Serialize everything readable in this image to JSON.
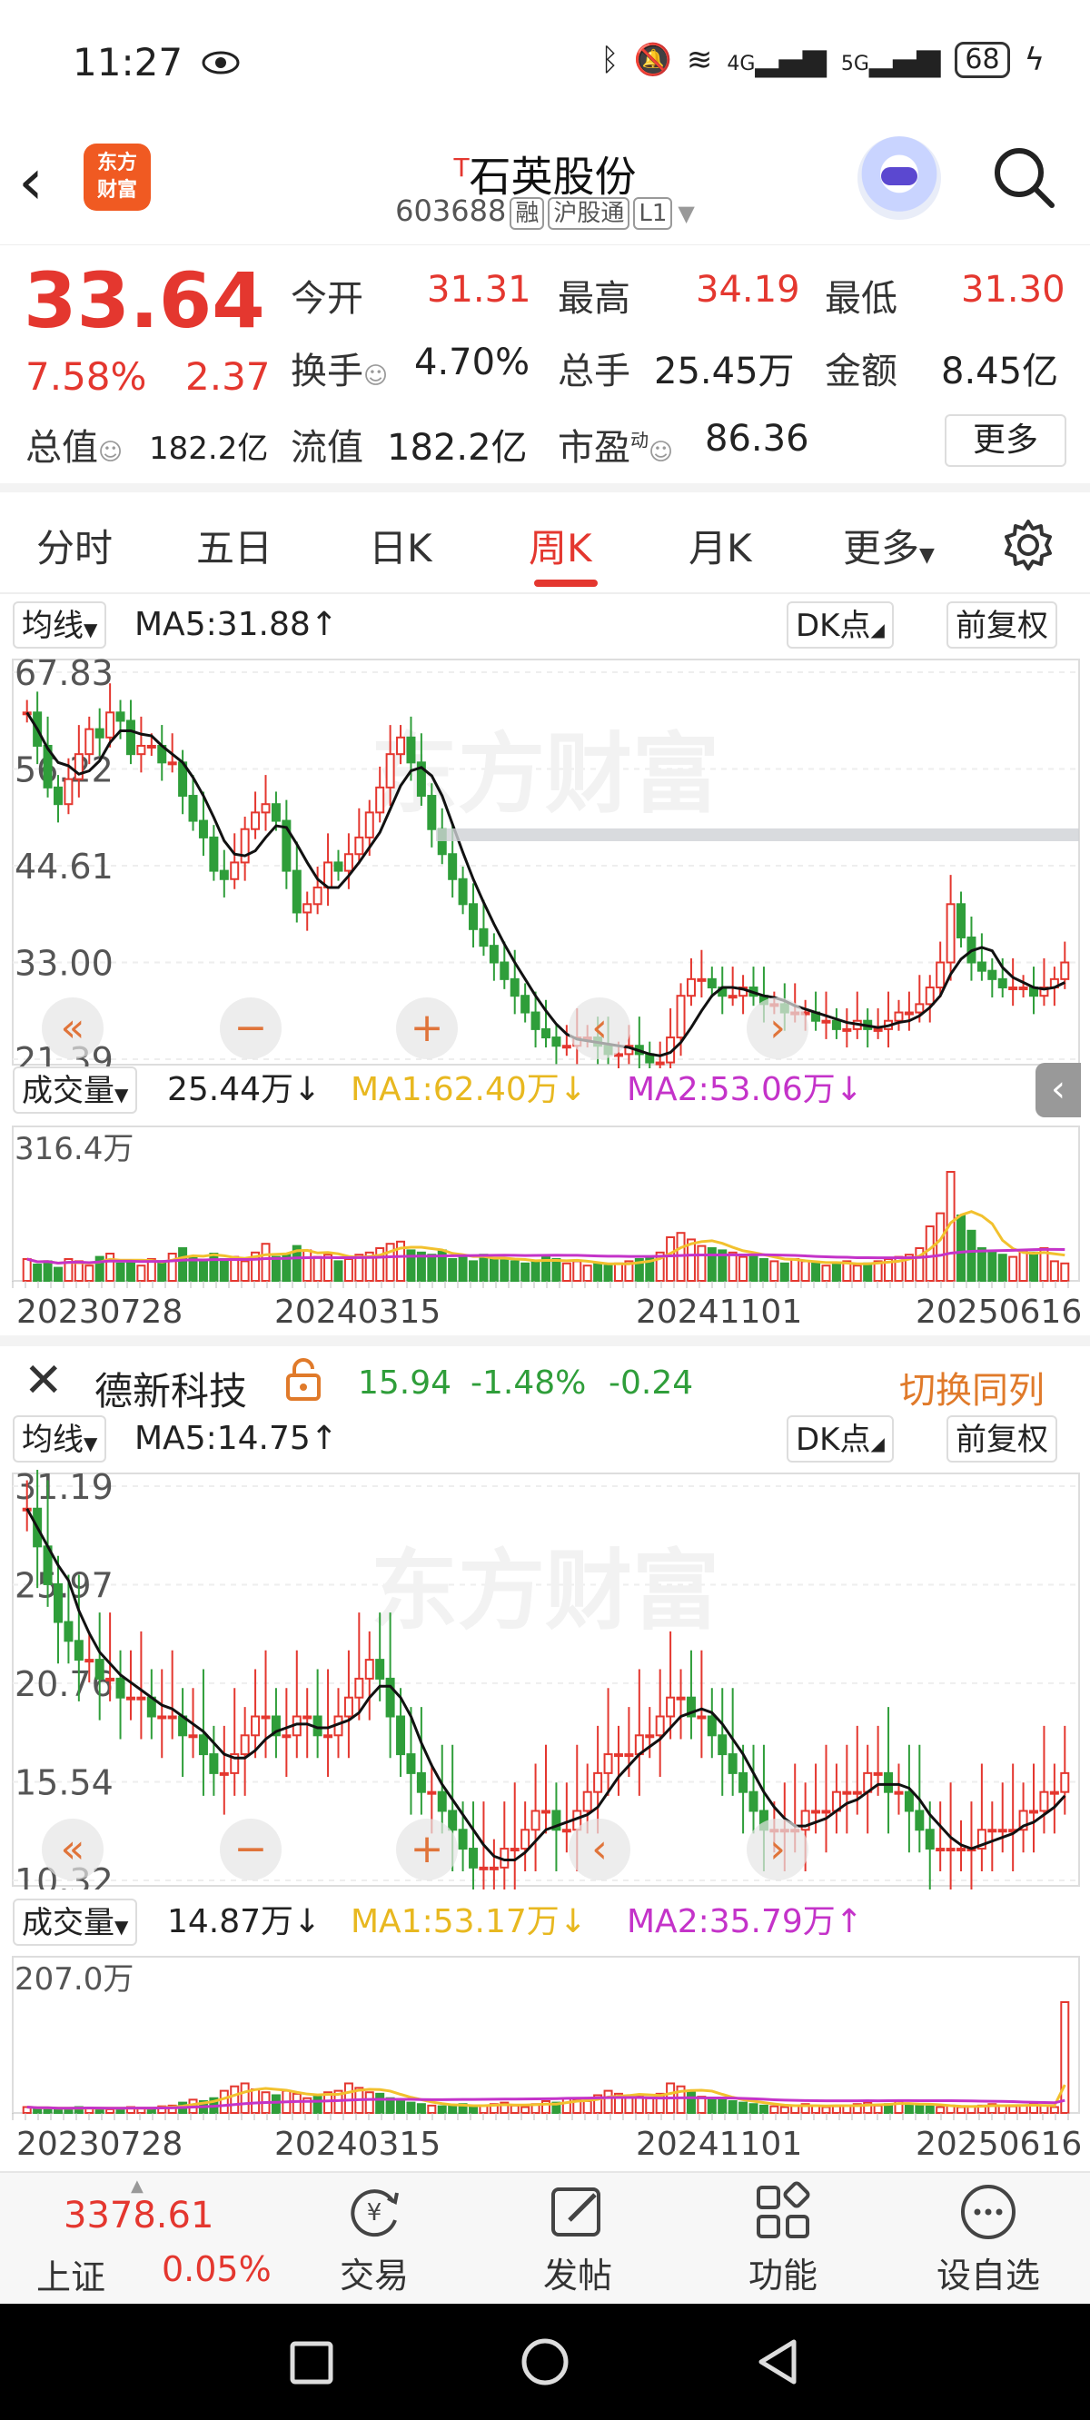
{
  "status": {
    "time": "11:27",
    "battery": "68",
    "net1": "4G",
    "net2": "5G"
  },
  "header": {
    "logo_top": "东方",
    "logo_bottom": "财富",
    "title_mark": "T",
    "title": "石英股份",
    "code": "603688",
    "tag1": "融",
    "tag2": "沪股通",
    "tag3": "L1"
  },
  "quote": {
    "price": "33.64",
    "pct": "7.58%",
    "chg": "2.37",
    "open_label": "今开",
    "open": "31.31",
    "high_label": "最高",
    "high": "34.19",
    "low_label": "最低",
    "low": "31.30",
    "turnover_label": "换手",
    "turnover": "4.70%",
    "vol_label": "总手",
    "vol": "25.45万",
    "amount_label": "金额",
    "amount": "8.45亿",
    "mktcap_label": "总值",
    "mktcap": "182.2亿",
    "float_label": "流值",
    "float": "182.2亿",
    "pe_label": "市盈",
    "pe_sup": "动",
    "pe": "86.36",
    "more": "更多"
  },
  "tabs": [
    "分时",
    "五日",
    "日K",
    "周K",
    "月K",
    "更多"
  ],
  "chart1": {
    "ma_select": "均线",
    "ma5": "MA5:31.88↑",
    "dk": "DK点",
    "adjust": "前复权",
    "y_labels": [
      "67.83",
      "56.22",
      "44.61",
      "33.00",
      "21.39"
    ],
    "vol_select": "成交量",
    "vol_value": "25.44万↓",
    "vol_ma1": "MA1:62.40万↓",
    "vol_ma2": "MA2:53.06万↓",
    "vol_max": "316.4万",
    "watermark": "东方财富",
    "closes": [
      63,
      59,
      54,
      52,
      55,
      58,
      61,
      60,
      63,
      62,
      58,
      59,
      59,
      57,
      57,
      53,
      50,
      48,
      44,
      43,
      45,
      49,
      51,
      52,
      50,
      44,
      39,
      40,
      42,
      45,
      44,
      46,
      48,
      51,
      54,
      58,
      60,
      57,
      53,
      49,
      46,
      43,
      40,
      37,
      35,
      33,
      31,
      29,
      27,
      25,
      24,
      23,
      23,
      24,
      24,
      23,
      22,
      22,
      23,
      22,
      21,
      21,
      24,
      29,
      31,
      31,
      30,
      29,
      29,
      30,
      29,
      28,
      28,
      27,
      27,
      27,
      26,
      26,
      25,
      25,
      26,
      25,
      25,
      26,
      27,
      27,
      28,
      30,
      33,
      40,
      36,
      33,
      32,
      31,
      30,
      30,
      30,
      29,
      30,
      31,
      33
    ],
    "vols": [
      20,
      15,
      18,
      12,
      20,
      18,
      14,
      22,
      25,
      16,
      18,
      14,
      20,
      18,
      25,
      30,
      22,
      18,
      25,
      20,
      22,
      18,
      26,
      34,
      22,
      24,
      32,
      28,
      22,
      24,
      18,
      20,
      24,
      26,
      30,
      34,
      36,
      28,
      26,
      24,
      28,
      20,
      22,
      18,
      24,
      20,
      20,
      18,
      16,
      18,
      22,
      20,
      16,
      18,
      14,
      16,
      14,
      16,
      18,
      20,
      22,
      26,
      40,
      44,
      38,
      32,
      30,
      28,
      26,
      22,
      24,
      20,
      18,
      16,
      20,
      18,
      16,
      14,
      16,
      18,
      14,
      16,
      18,
      20,
      22,
      24,
      30,
      50,
      62,
      100,
      60,
      46,
      30,
      26,
      24,
      22,
      28,
      26,
      30,
      18,
      16
    ]
  },
  "x_dates": [
    "20230728",
    "20240315",
    "20241101",
    "20250616"
  ],
  "compare": {
    "name": "德新科技",
    "price": "15.94",
    "pct": "-1.48%",
    "chg": "-0.24",
    "switch": "切换同列"
  },
  "chart2": {
    "ma_select": "均线",
    "ma5": "MA5:14.75↑",
    "dk": "DK点",
    "adjust": "前复权",
    "y_labels": [
      "31.19",
      "25.97",
      "20.76",
      "15.54",
      "10.32"
    ],
    "vol_select": "成交量",
    "vol_value": "14.87万↓",
    "vol_ma1": "MA1:53.17万↓",
    "vol_ma2": "MA2:35.79万↑",
    "vol_max": "207.0万",
    "watermark": "东方财富",
    "closes": [
      30,
      28,
      26,
      24,
      23,
      22,
      22,
      21,
      21,
      20,
      20,
      20,
      19,
      19,
      19,
      18,
      18,
      17,
      16,
      16,
      17,
      18,
      19,
      19,
      18,
      18,
      19,
      19,
      18,
      18,
      19,
      20,
      21,
      22,
      21,
      19,
      17,
      16,
      15,
      15,
      14,
      13,
      12,
      11,
      11,
      11,
      12,
      12,
      13,
      14,
      14,
      13,
      13,
      14,
      15,
      16,
      17,
      17,
      17,
      18,
      18,
      19,
      20,
      20,
      19,
      19,
      18,
      17,
      16,
      15,
      14,
      13,
      13,
      13,
      13,
      14,
      14,
      14,
      15,
      15,
      15,
      16,
      16,
      15,
      15,
      14,
      13,
      12,
      12,
      12,
      12,
      12,
      13,
      13,
      13,
      13,
      14,
      14,
      15,
      15,
      16
    ],
    "vols": [
      8,
      6,
      7,
      5,
      6,
      8,
      7,
      6,
      5,
      6,
      8,
      7,
      6,
      9,
      10,
      14,
      18,
      16,
      20,
      30,
      36,
      40,
      32,
      28,
      24,
      30,
      26,
      20,
      22,
      28,
      30,
      40,
      34,
      28,
      26,
      20,
      18,
      14,
      12,
      10,
      9,
      10,
      12,
      8,
      10,
      12,
      14,
      10,
      8,
      12,
      16,
      14,
      20,
      18,
      16,
      24,
      30,
      26,
      22,
      24,
      20,
      26,
      40,
      36,
      30,
      22,
      20,
      18,
      16,
      14,
      12,
      10,
      9,
      8,
      10,
      12,
      10,
      8,
      9,
      10,
      12,
      14,
      10,
      12,
      16,
      12,
      10,
      9,
      8,
      10,
      8,
      9,
      10,
      12,
      10,
      9,
      10,
      12,
      10,
      8,
      150
    ]
  },
  "toolbar": {
    "index_value": "3378.61",
    "index_name": "上证",
    "index_pct": "0.05%",
    "trade": "交易",
    "post": "发帖",
    "func": "功能",
    "watch": "设自选"
  },
  "colors": {
    "up": "#e4372f",
    "down": "#2f9e3a",
    "ma": "#111111",
    "ma1": "#f2c12e",
    "ma2": "#c433c9"
  }
}
